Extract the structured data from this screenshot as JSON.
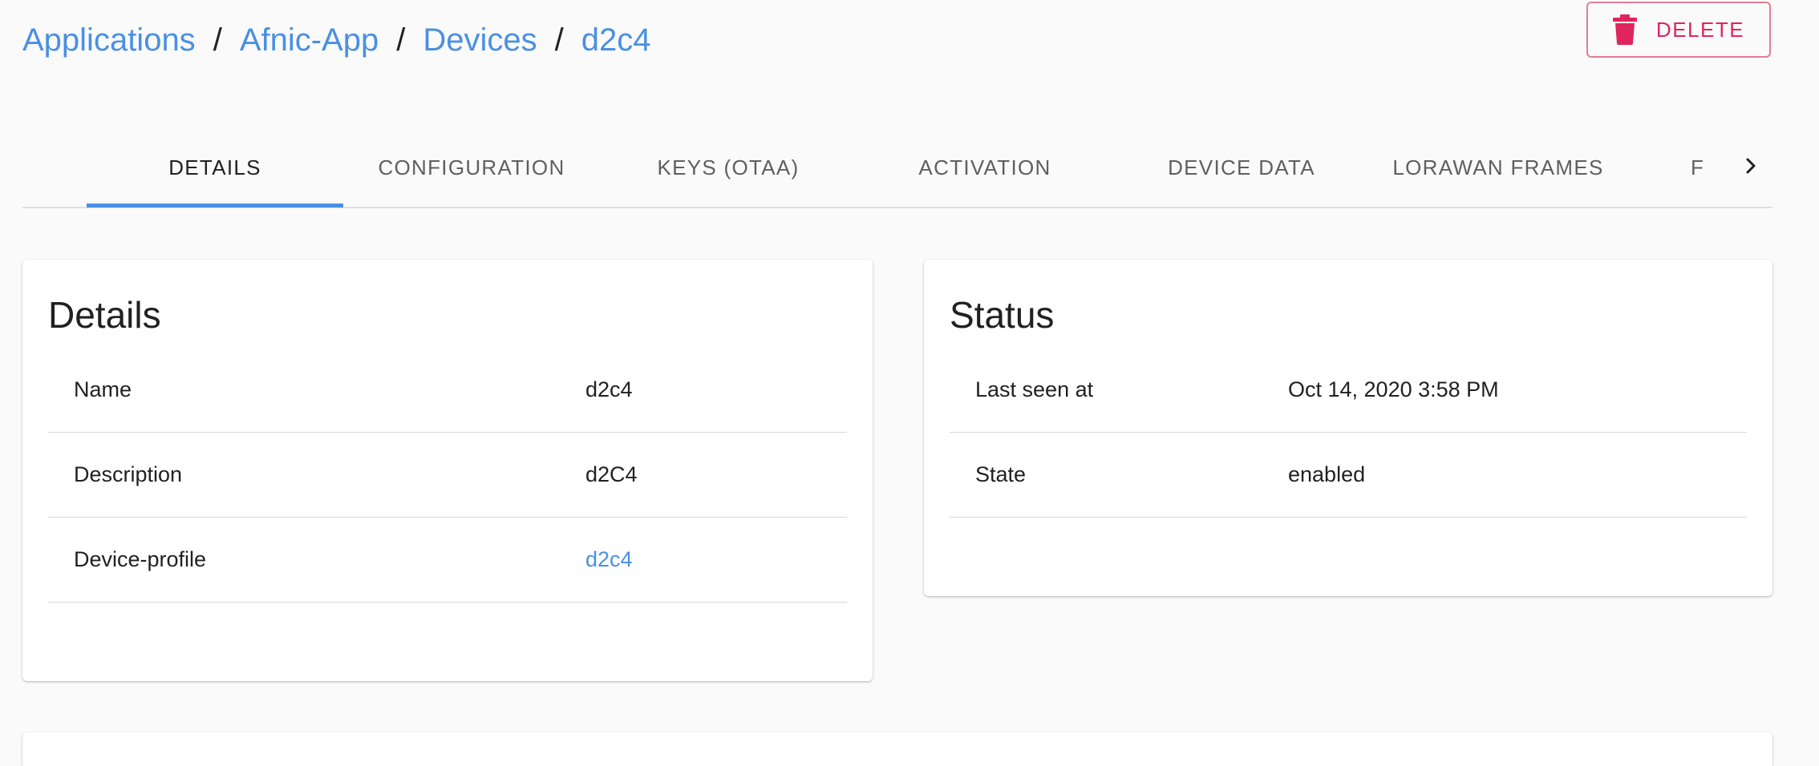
{
  "breadcrumb": {
    "items": [
      "Applications",
      "Afnic-App",
      "Devices",
      "d2c4"
    ],
    "separator": "/"
  },
  "actions": {
    "delete_label": "DELETE",
    "delete_icon": "trash-icon",
    "delete_color": "#e0245e"
  },
  "tabs": {
    "items": [
      "DETAILS",
      "CONFIGURATION",
      "KEYS (OTAA)",
      "ACTIVATION",
      "DEVICE DATA",
      "LORAWAN FRAMES"
    ],
    "partial": "F",
    "active_index": 0,
    "scroll_icon": "chevron-right-icon",
    "accent": "#4a90e2"
  },
  "details": {
    "title": "Details",
    "rows": [
      {
        "key": "Name",
        "value": "d2c4"
      },
      {
        "key": "Description",
        "value": "d2C4"
      },
      {
        "key": "Device-profile",
        "value": "d2c4"
      }
    ]
  },
  "status": {
    "title": "Status",
    "rows": [
      {
        "key": "Last seen at",
        "value": "Oct 14, 2020 3:58 PM"
      },
      {
        "key": "State",
        "value": "enabled"
      }
    ]
  }
}
